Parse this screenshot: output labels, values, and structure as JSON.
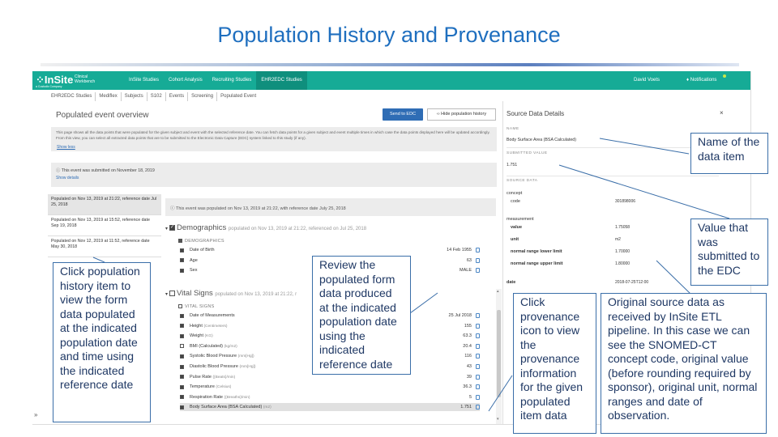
{
  "slide": {
    "title": "Population History and Provenance"
  },
  "app": {
    "logo": {
      "name": "InSite",
      "sub": "Clinical Workbench",
      "tagline": "a Custodix Company"
    },
    "nav": [
      {
        "label": "InSite Studies"
      },
      {
        "label": "Cohort Analysis"
      },
      {
        "label": "Recruiting Studies"
      },
      {
        "label": "EHR2EDC Studies",
        "active": true
      }
    ],
    "user": "David Voets",
    "notifications": "Notifications",
    "breadcrumb": [
      "EHR2EDC Studies",
      "Mediflex",
      "Subjects",
      "S102",
      "Events",
      "Screening",
      "Populated Event"
    ],
    "page_title": "Populated event overview",
    "send_button": "Send to EDC",
    "hide_button": "Hide population history",
    "intro_text": "This page shows all the data points that were populated for the given subject and event with the selected reference date. You can fetch data points for a given subject and event multiple times in which case the data points displayed here will be updated accordingly. From this view, you can select all extracted data points that are to be submitted to the Electronic Data Capture (EDC) system linked to this study (if any).",
    "show_less": "Show less",
    "submitted_text": "This event was submitted on November 18, 2019",
    "show_details": "Show details",
    "history": [
      {
        "text": "Populated on Nov 13, 2019 at 21:22, reference date Jul 25, 2018",
        "selected": true
      },
      {
        "text": "Populated on Nov 13, 2019 at 15:52, reference date Sep 19, 2018"
      },
      {
        "text": "Populated on Nov 12, 2019 at 11:52, reference date May 30, 2018"
      }
    ],
    "population_banner": "This event was populated on Nov 13, 2019 at 21:22, with reference date July 25, 2018",
    "demographics": {
      "title": "Demographics",
      "subtitle": "populated on Nov 13, 2019 at 21:22, referenced on Jul 25, 2018",
      "group": "DEMOGRAPHICS",
      "rows": [
        {
          "label": "Date of Birth",
          "unit": "",
          "value": "14 Feb 1955"
        },
        {
          "label": "Age",
          "unit": "",
          "value": "63"
        },
        {
          "label": "Sex",
          "unit": "",
          "value": "MALE"
        }
      ]
    },
    "vitals": {
      "title": "Vital Signs",
      "subtitle": "populated on Nov 13, 2019 at 21:22, r",
      "group": "VITAL SIGNS",
      "rows": [
        {
          "label": "Date of Measurements",
          "unit": "",
          "value": "25 Jul 2018",
          "checked": true
        },
        {
          "label": "Height",
          "unit": "(Centimeters)",
          "value": "155",
          "checked": true
        },
        {
          "label": "Weight",
          "unit": "(KG)",
          "value": "63.3",
          "checked": true
        },
        {
          "label": "BMI (Calculated)",
          "unit": "(kg/m2)",
          "value": "20.4",
          "checked": false
        },
        {
          "label": "Systolic Blood Pressure",
          "unit": "(mm[Hg])",
          "value": "116",
          "checked": true
        },
        {
          "label": "Diastolic Blood Pressure",
          "unit": "(mm[Hg])",
          "value": "43",
          "checked": true
        },
        {
          "label": "Pulse Rate",
          "unit": "({Beats}/min)",
          "value": "39",
          "checked": true
        },
        {
          "label": "Temperature",
          "unit": "(Celsius)",
          "value": "36.3",
          "checked": true
        },
        {
          "label": "Respiration Rate",
          "unit": "({Breaths}/min)",
          "value": "5",
          "checked": true
        },
        {
          "label": "Body Surface Area (BSA Calculated)",
          "unit": "(m2)",
          "value": "1.751",
          "checked": true,
          "highlight": true
        }
      ]
    },
    "details": {
      "title": "Source Data Details",
      "close": "×",
      "name_label": "NAME",
      "name_value": "Body Surface Area (BSA Calculated)",
      "submitted_label": "SUBMITTED VALUE",
      "submitted_value": "1.751",
      "source_label": "SOURCE DATA",
      "concept_label": "concept",
      "code_key": "code",
      "code_value": "301898006",
      "measurement_label": "measurement",
      "value_key": "value",
      "value_value": "1.75058",
      "unit_key": "unit",
      "unit_value": "m2",
      "lower_key": "normal range lower limit",
      "lower_value": "1.70000",
      "upper_key": "normal range upper limit",
      "upper_value": "1.80000",
      "date_key": "date",
      "date_value": "2018-07-25T12:00"
    }
  },
  "callouts": {
    "name": "Name of the data item",
    "value": "Value that was submitted to the EDC",
    "review": "Review the populated form data produced at the indicated population date using the indicated reference date",
    "history": "Click population history item to view the form data populated at the indicated population date and time using the indicated reference date",
    "provenance": "Click provenance icon to view the provenance information for the given populated item data",
    "original": "Original source data as received by InSite ETL pipeline. In this case we can see the SNOMED-CT concept code, original value (before rounding required by sponsor), original unit, normal ranges and date of observation."
  }
}
